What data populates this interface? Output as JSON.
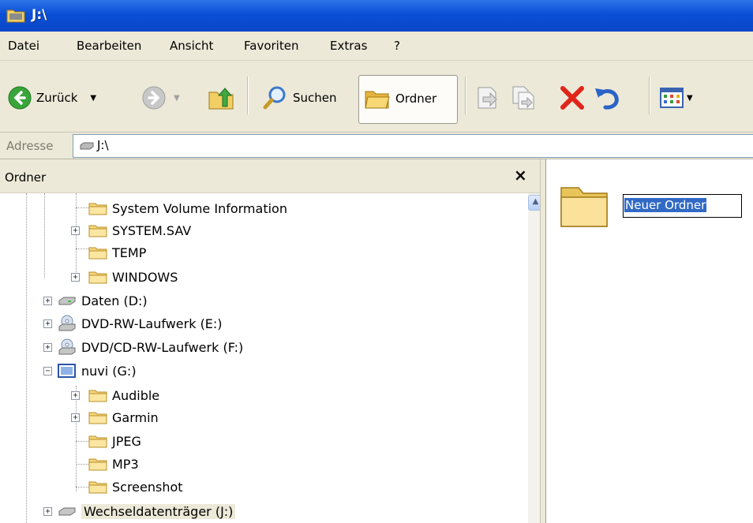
{
  "window": {
    "title": "J:\\"
  },
  "menu": [
    "Datei",
    "Bearbeiten",
    "Ansicht",
    "Favoriten",
    "Extras",
    "?"
  ],
  "toolbar": {
    "back_label": "Zurück",
    "search_label": "Suchen",
    "folders_label": "Ordner"
  },
  "address": {
    "label": "Adresse",
    "value": "J:\\"
  },
  "folder_pane": {
    "title": "Ordner",
    "close_glyph": "×"
  },
  "tree": [
    {
      "label": "System Volume Information",
      "icon": "folder-icon",
      "expandable": false
    },
    {
      "label": "SYSTEM.SAV",
      "icon": "folder-icon",
      "expandable": true
    },
    {
      "label": "TEMP",
      "icon": "folder-icon",
      "expandable": false
    },
    {
      "label": "WINDOWS",
      "icon": "folder-icon",
      "expandable": true
    },
    {
      "label": "Daten (D:)",
      "icon": "hard-drive-icon",
      "expandable": true
    },
    {
      "label": "DVD-RW-Laufwerk (E:)",
      "icon": "dvd-drive-icon",
      "expandable": true
    },
    {
      "label": "DVD/CD-RW-Laufwerk (F:)",
      "icon": "dvd-drive-icon",
      "expandable": true
    },
    {
      "label": "nuvi (G:)",
      "icon": "device-icon",
      "expandable": true,
      "expanded": true
    },
    {
      "label": "Audible",
      "icon": "folder-icon",
      "expandable": true
    },
    {
      "label": "Garmin",
      "icon": "folder-icon",
      "expandable": true
    },
    {
      "label": "JPEG",
      "icon": "folder-icon",
      "expandable": false
    },
    {
      "label": "MP3",
      "icon": "folder-icon",
      "expandable": false
    },
    {
      "label": "Screenshot",
      "icon": "folder-icon",
      "expandable": false
    },
    {
      "label": "Wechseldatenträger (J:)",
      "icon": "removable-drive-icon",
      "expandable": true,
      "selected": true
    }
  ],
  "content": {
    "new_folder_name": "Neuer Ordner"
  },
  "colors": {
    "titlebar": "#0a4fd6",
    "chrome": "#ece9d8",
    "selection": "#316ac5",
    "delete_red": "#e0251b"
  }
}
